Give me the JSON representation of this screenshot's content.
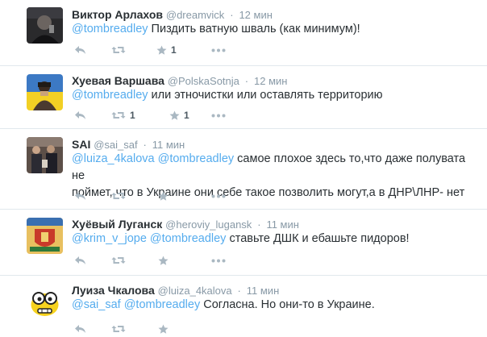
{
  "tweets": [
    {
      "name": "Виктор Арлахов",
      "handle": "@dreamvick",
      "time": "12 мин",
      "mentions": [
        "@tombreadley"
      ],
      "text": " Пиздить ватную шваль (как минимум)!",
      "text_line2": "",
      "retweets": "",
      "favorites": "1"
    },
    {
      "name": "Хуевая Варшава",
      "handle": "@PolskaSotnja",
      "time": "12 мин",
      "mentions": [
        "@tombreadley"
      ],
      "text": " или этночистки или оставлять территорию",
      "text_line2": "",
      "retweets": "1",
      "favorites": "1"
    },
    {
      "name": "SAI",
      "handle": "@sai_saf",
      "time": "11 мин",
      "mentions": [
        "@luiza_4kalova",
        "@tombreadley"
      ],
      "text": " самое плохое здесь то,что даже полувата не",
      "text_line2": "поймет, что в Украине они себе такое позволить могут,а в ДНР\\ЛНР- нет",
      "retweets": "",
      "favorites": ""
    },
    {
      "name": "Хуёвый Луганск",
      "handle": "@heroviy_lugansk",
      "time": "11 мин",
      "mentions": [
        "@krim_v_jope",
        "@tombreadley"
      ],
      "text": " ставьте ДШК и ебашьте пидоров!",
      "text_line2": "",
      "retweets": "",
      "favorites": ""
    },
    {
      "name": "Луиза Чкалова",
      "handle": "@luiza_4kalova",
      "time": "11 мин",
      "mentions": [
        "@sai_saf",
        "@tombreadley"
      ],
      "text": " Согласна. Но они-то в Украине.",
      "text_line2": "",
      "retweets": "",
      "favorites": ""
    }
  ],
  "separator": "·",
  "colors": {
    "link": "#55acee",
    "meta": "#8899a6",
    "icon": "#aab8c2",
    "divider": "#e1e8ed"
  },
  "icons": [
    "reply-icon",
    "retweet-icon",
    "favorite-icon",
    "more-icon"
  ]
}
